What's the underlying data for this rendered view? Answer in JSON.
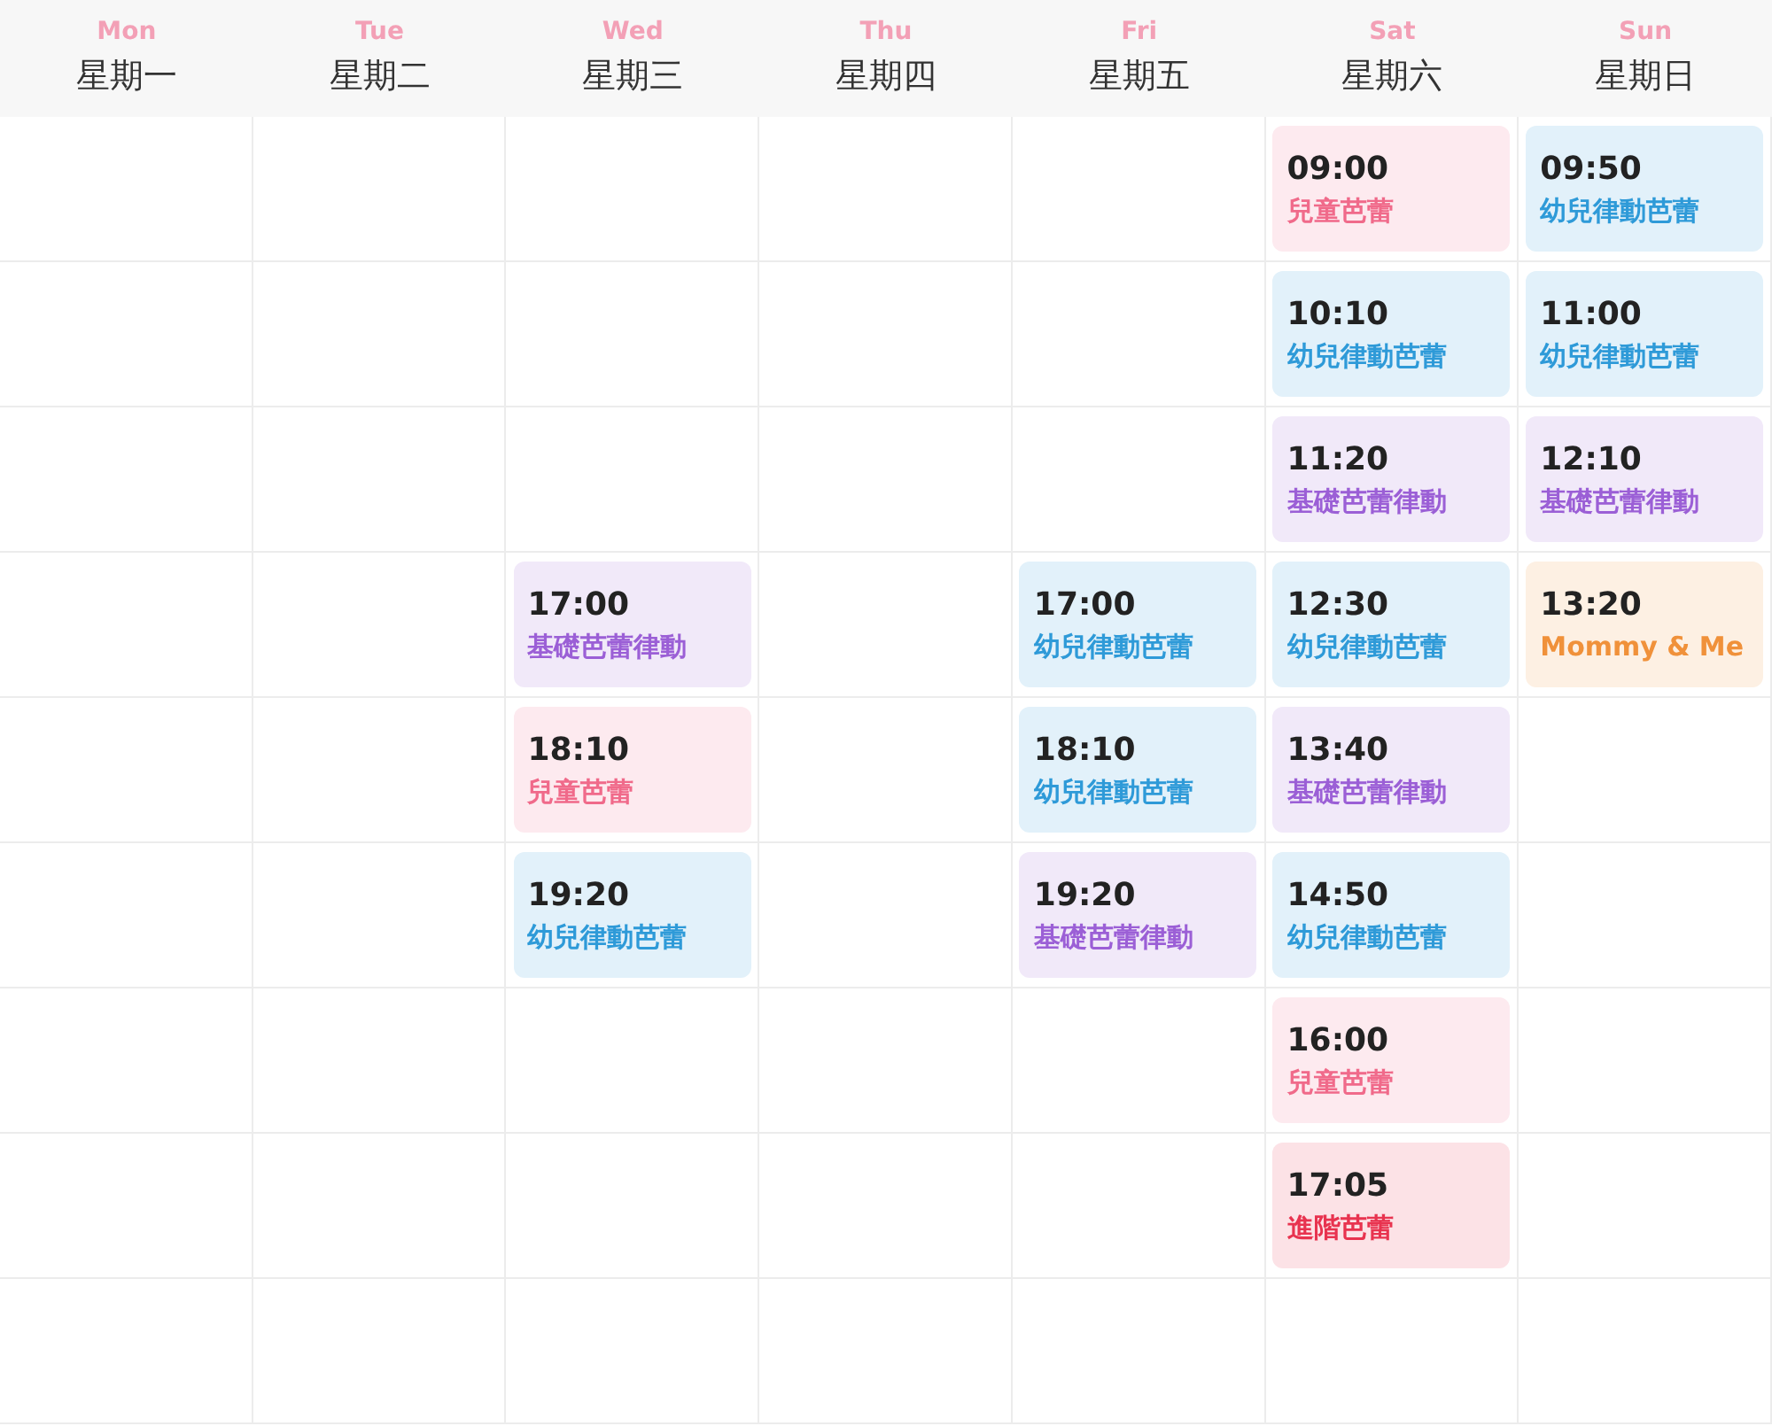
{
  "days": [
    {
      "abbr": "Mon",
      "name": "星期一"
    },
    {
      "abbr": "Tue",
      "name": "星期二"
    },
    {
      "abbr": "Wed",
      "name": "星期三"
    },
    {
      "abbr": "Thu",
      "name": "星期四"
    },
    {
      "abbr": "Fri",
      "name": "星期五"
    },
    {
      "abbr": "Sat",
      "name": "星期六"
    },
    {
      "abbr": "Sun",
      "name": "星期日"
    }
  ],
  "rows": [
    {
      "cells": [
        null,
        null,
        null,
        null,
        null,
        {
          "time": "09:00",
          "name": "兒童芭蕾",
          "color": "#f06a8a"
        },
        {
          "time": "09:50",
          "name": "幼兒律動芭蕾",
          "color": "#2e9ad8"
        }
      ]
    },
    {
      "cells": [
        null,
        null,
        null,
        null,
        null,
        {
          "time": "10:10",
          "name": "幼兒律動芭蕾",
          "color": "#2e9ad8"
        },
        {
          "time": "11:00",
          "name": "幼兒律動芭蕾",
          "color": "#2e9ad8"
        }
      ]
    },
    {
      "cells": [
        null,
        null,
        null,
        null,
        null,
        {
          "time": "11:20",
          "name": "基礎芭蕾律動",
          "color": "#9b5fd6"
        },
        {
          "time": "12:10",
          "name": "基礎芭蕾律動",
          "color": "#9b5fd6"
        }
      ]
    },
    {
      "cells": [
        null,
        null,
        {
          "time": "17:00",
          "name": "基礎芭蕾律動",
          "color": "#9b5fd6"
        },
        null,
        {
          "time": "17:00",
          "name": "幼兒律動芭蕾",
          "color": "#2e9ad8"
        },
        {
          "time": "12:30",
          "name": "幼兒律動芭蕾",
          "color": "#2e9ad8"
        },
        {
          "time": "13:20",
          "name": "Mommy & Me",
          "color": "#f0913a"
        }
      ]
    },
    {
      "cells": [
        null,
        null,
        {
          "time": "18:10",
          "name": "兒童芭蕾",
          "color": "#f06a8a"
        },
        null,
        {
          "time": "18:10",
          "name": "幼兒律動芭蕾",
          "color": "#2e9ad8"
        },
        {
          "time": "13:40",
          "name": "基礎芭蕾律動",
          "color": "#9b5fd6"
        },
        null
      ]
    },
    {
      "cells": [
        null,
        null,
        {
          "time": "19:20",
          "name": "幼兒律動芭蕾",
          "color": "#2e9ad8"
        },
        null,
        {
          "time": "19:20",
          "name": "基礎芭蕾律動",
          "color": "#9b5fd6"
        },
        {
          "time": "14:50",
          "name": "幼兒律動芭蕾",
          "color": "#2e9ad8"
        },
        null
      ]
    },
    {
      "cells": [
        null,
        null,
        null,
        null,
        null,
        {
          "time": "16:00",
          "name": "兒童芭蕾",
          "color": "#f06a8a"
        },
        null
      ]
    },
    {
      "cells": [
        null,
        null,
        null,
        null,
        null,
        {
          "time": "17:05",
          "name": "進階芭蕾",
          "color": "#e8334f"
        },
        null
      ]
    },
    {
      "cells": [
        null,
        null,
        null,
        null,
        null,
        null,
        null
      ]
    }
  ]
}
